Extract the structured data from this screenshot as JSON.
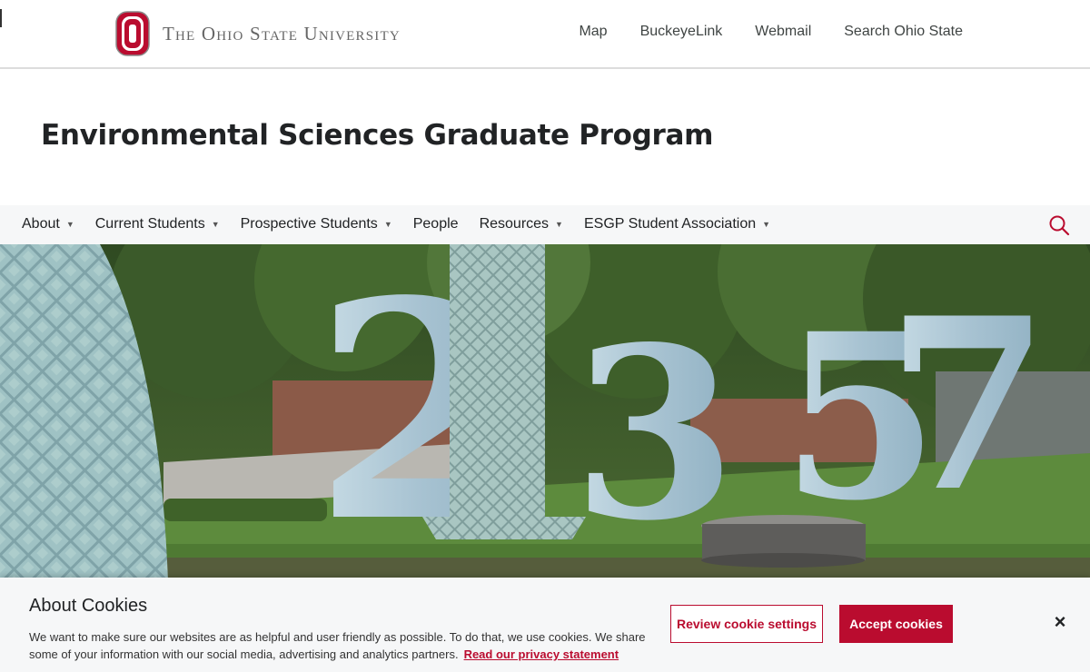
{
  "header": {
    "university_name": "The Ohio State University",
    "links": [
      "Map",
      "BuckeyeLink",
      "Webmail",
      "Search Ohio State"
    ]
  },
  "site": {
    "title": "Environmental Sciences Graduate Program"
  },
  "nav": {
    "items": [
      {
        "label": "About",
        "dropdown": true
      },
      {
        "label": "Current Students",
        "dropdown": true
      },
      {
        "label": "Prospective Students",
        "dropdown": true
      },
      {
        "label": "People",
        "dropdown": false
      },
      {
        "label": "Resources",
        "dropdown": true
      },
      {
        "label": "ESGP Student Association",
        "dropdown": true
      }
    ],
    "search_icon": "search-icon"
  },
  "hero": {
    "numbers": [
      "2",
      "1",
      "3",
      "5",
      "7"
    ]
  },
  "cookie": {
    "title": "About Cookies",
    "text": "We want to make sure our websites are as helpful and user friendly as possible. To do that, we use cookies. We share some of your information with our social media, advertising and analytics partners.",
    "link": "Read our privacy statement",
    "review_button": "Review cookie settings",
    "accept_button": "Accept cookies",
    "close": "×"
  },
  "colors": {
    "scarlet": "#ba0c2f",
    "gray_bg": "#f6f7f8"
  }
}
